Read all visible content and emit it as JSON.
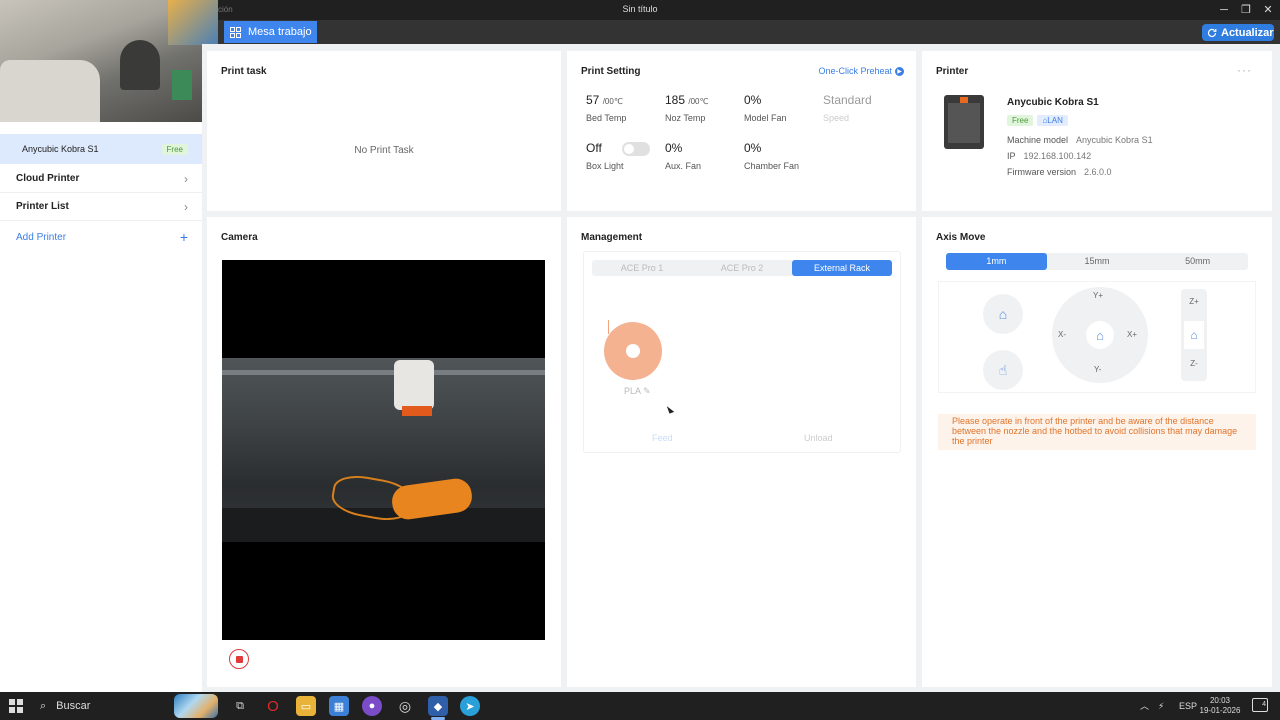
{
  "window": {
    "title": "Sin título",
    "title_fragment": "ción",
    "minimize": "─",
    "maximize": "❐",
    "close": "✕"
  },
  "toolbar": {
    "workspace_tab": "Mesa trabajo",
    "refresh_label": "Actualizar"
  },
  "sidebar": {
    "selected_printer": "Anycubic Kobra S1",
    "selected_status": "Free",
    "items": [
      {
        "label": "Cloud Printer"
      },
      {
        "label": "Printer List"
      }
    ],
    "add_label": "Add Printer"
  },
  "print_task": {
    "title": "Print task",
    "empty_text": "No Print Task"
  },
  "print_setting": {
    "title": "Print Setting",
    "preheat_link": "One-Click Preheat",
    "bed_temp": {
      "value": "57",
      "target": "/00℃",
      "label": "Bed Temp"
    },
    "noz_temp": {
      "value": "185",
      "target": "/00℃",
      "label": "Noz Temp"
    },
    "model_fan": {
      "value": "0%",
      "label": "Model Fan"
    },
    "speed": {
      "value": "Standard",
      "label": "Speed"
    },
    "box_light": {
      "value": "Off",
      "label": "Box Light",
      "on": false
    },
    "aux_fan": {
      "value": "0%",
      "label": "Aux. Fan"
    },
    "chamber_fan": {
      "value": "0%",
      "label": "Chamber Fan"
    }
  },
  "printer": {
    "title": "Printer",
    "more": "···",
    "name": "Anycubic Kobra S1",
    "status_badge": "Free",
    "connection_badge": "LAN",
    "machine_model_label": "Machine model",
    "machine_model": "Anycubic Kobra S1",
    "ip_label": "IP",
    "ip": "192.168.100.142",
    "firmware_label": "Firmware version",
    "firmware": "2.6.0.0"
  },
  "camera": {
    "title": "Camera"
  },
  "management": {
    "title": "Management",
    "tabs": [
      {
        "label": "ACE Pro 1"
      },
      {
        "label": "ACE Pro 2"
      },
      {
        "label": "External Rack"
      }
    ],
    "active_tab": 2,
    "filament": {
      "type": "PLA",
      "color": "#f3a57e"
    },
    "feed_label": "Feed",
    "unload_label": "Unload"
  },
  "axis_move": {
    "title": "Axis Move",
    "steps": [
      {
        "label": "1mm"
      },
      {
        "label": "15mm"
      },
      {
        "label": "50mm"
      }
    ],
    "active_step": 0,
    "labels": {
      "y_plus": "Y+",
      "y_minus": "Y-",
      "x_minus": "X-",
      "x_plus": "X+",
      "z_plus": "Z+",
      "z_minus": "Z-"
    },
    "warning": "Please operate in front of the printer and be aware of the distance between the nozzle and the hotbed to avoid collisions that may damage the printer"
  },
  "taskbar": {
    "search_placeholder": "Buscar",
    "language": "ESP",
    "time": "20:03",
    "date": "19-01-2026",
    "notification_count": "4"
  },
  "colors": {
    "accent": "#3e86ee",
    "free_green": "#4d9a3c",
    "warning_orange": "#e0742b",
    "record_red": "#e23a3a"
  }
}
